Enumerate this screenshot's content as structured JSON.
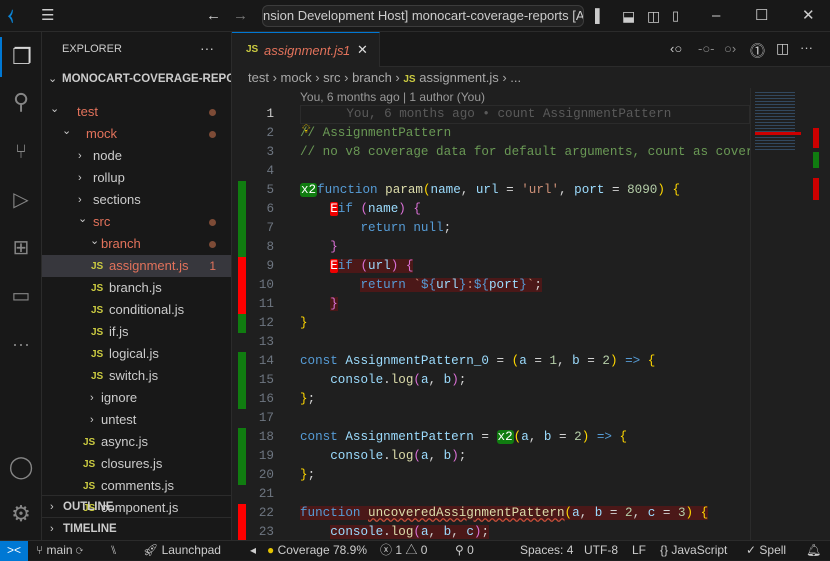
{
  "titlebar": {
    "title": "nsion Development Host] monocart-coverage-reports [Admi"
  },
  "sidebar": {
    "header": "EXPLORER",
    "more": "···",
    "root": "MONOCART-COVERAGE-REPO...",
    "outline": "OUTLINE",
    "timeline": "TIMELINE",
    "items": [
      {
        "label": "test",
        "kind": "folder-open",
        "depth": 0,
        "modified": true
      },
      {
        "label": "mock",
        "kind": "folder-open",
        "depth": 1,
        "modified": true
      },
      {
        "label": "node",
        "kind": "folder",
        "depth": 2
      },
      {
        "label": "rollup",
        "kind": "folder",
        "depth": 2
      },
      {
        "label": "sections",
        "kind": "folder",
        "depth": 2
      },
      {
        "label": "src",
        "kind": "folder-open",
        "depth": 2,
        "modified": true
      },
      {
        "label": "branch",
        "kind": "folder-open",
        "depth": 3,
        "modified": true
      },
      {
        "label": "assignment.js",
        "kind": "js",
        "depth": 4,
        "selected": true,
        "problems": "1"
      },
      {
        "label": "branch.js",
        "kind": "js",
        "depth": 4
      },
      {
        "label": "conditional.js",
        "kind": "js",
        "depth": 4
      },
      {
        "label": "if.js",
        "kind": "js",
        "depth": 4
      },
      {
        "label": "logical.js",
        "kind": "js",
        "depth": 4
      },
      {
        "label": "switch.js",
        "kind": "js",
        "depth": 4
      },
      {
        "label": "ignore",
        "kind": "folder",
        "depth": 3
      },
      {
        "label": "untest",
        "kind": "folder",
        "depth": 3
      },
      {
        "label": "async.js",
        "kind": "js",
        "depth": 3
      },
      {
        "label": "closures.js",
        "kind": "js",
        "depth": 3
      },
      {
        "label": "comments.js",
        "kind": "js",
        "depth": 3
      },
      {
        "label": "component.js",
        "kind": "js",
        "depth": 3
      }
    ]
  },
  "tab": {
    "icon": "JS",
    "label": "assignment.js",
    "problems": "1"
  },
  "breadcrumbs": [
    "test",
    "mock",
    "src",
    "branch",
    "assignment.js",
    "..."
  ],
  "blame": "You, 6 months ago | 1 author (You)",
  "code": {
    "lines": [
      {
        "n": "1",
        "cov": "",
        "t": [
          [
            "      You, 6 months ago • count AssignmentPattern",
            "ghost"
          ]
        ]
      },
      {
        "n": "2",
        "cov": "",
        "t": [
          [
            "// AssignmentPattern",
            "cm"
          ]
        ]
      },
      {
        "n": "3",
        "cov": "",
        "t": [
          [
            "// no v8 coverage data for default arguments, count as covered",
            "cm"
          ]
        ]
      },
      {
        "n": "4",
        "cov": "",
        "t": []
      },
      {
        "n": "5",
        "cov": "covered",
        "t": [
          [
            "x2",
            "bx2"
          ],
          [
            "function ",
            "kw"
          ],
          [
            "param",
            "fn"
          ],
          [
            "(",
            "b1"
          ],
          [
            "name",
            "var"
          ],
          [
            ", ",
            "p"
          ],
          [
            "url",
            "var"
          ],
          [
            " = ",
            "p"
          ],
          [
            "'url'",
            "str"
          ],
          [
            ", ",
            "p"
          ],
          [
            "port",
            "var"
          ],
          [
            " = ",
            "p"
          ],
          [
            "8090",
            "num"
          ],
          [
            ") ",
            "b1"
          ],
          [
            "{",
            "b1"
          ]
        ]
      },
      {
        "n": "6",
        "cov": "covered",
        "t": [
          [
            "    ",
            "p"
          ],
          [
            "E",
            "bE"
          ],
          [
            "if ",
            "kw"
          ],
          [
            "(",
            "b2"
          ],
          [
            "name",
            "var"
          ],
          [
            ") ",
            "b2"
          ],
          [
            "{",
            "b2"
          ]
        ]
      },
      {
        "n": "7",
        "cov": "covered",
        "t": [
          [
            "        return ",
            "kw"
          ],
          [
            "null",
            "kw"
          ],
          [
            ";",
            "p"
          ]
        ]
      },
      {
        "n": "8",
        "cov": "covered",
        "t": [
          [
            "    ",
            "p"
          ],
          [
            "}",
            "b2"
          ]
        ]
      },
      {
        "n": "9",
        "cov": "uncovered",
        "t": [
          [
            "    ",
            "p"
          ],
          [
            "E",
            "bE"
          ],
          [
            "if ",
            "kw unc"
          ],
          [
            "(",
            "b2 unc"
          ],
          [
            "url",
            "var unc"
          ],
          [
            ") ",
            "b2 unc"
          ],
          [
            "{",
            "b2 unc"
          ]
        ]
      },
      {
        "n": "10",
        "cov": "uncovered",
        "t": [
          [
            "        ",
            "p"
          ],
          [
            "return ",
            "kw unc"
          ],
          [
            "`",
            "str unc"
          ],
          [
            "${",
            "tpl unc"
          ],
          [
            "url",
            "var unc"
          ],
          [
            "}",
            "tpl unc"
          ],
          [
            ":",
            "str unc"
          ],
          [
            "${",
            "tpl unc"
          ],
          [
            "port",
            "var unc"
          ],
          [
            "}",
            "tpl unc"
          ],
          [
            "`",
            "str unc"
          ],
          [
            ";",
            "p unc"
          ]
        ]
      },
      {
        "n": "11",
        "cov": "uncovered",
        "t": [
          [
            "    ",
            "p"
          ],
          [
            "}",
            "b2 unc"
          ]
        ]
      },
      {
        "n": "12",
        "cov": "covered",
        "t": [
          [
            "}",
            "b1"
          ]
        ]
      },
      {
        "n": "13",
        "cov": "",
        "t": []
      },
      {
        "n": "14",
        "cov": "covered",
        "t": [
          [
            "const ",
            "kw"
          ],
          [
            "AssignmentPattern_0",
            "var"
          ],
          [
            " = ",
            "p"
          ],
          [
            "(",
            "b1"
          ],
          [
            "a",
            "var"
          ],
          [
            " = ",
            "p"
          ],
          [
            "1",
            "num"
          ],
          [
            ", ",
            "p"
          ],
          [
            "b",
            "var"
          ],
          [
            " = ",
            "p"
          ],
          [
            "2",
            "num"
          ],
          [
            ") ",
            "b1"
          ],
          [
            "=> ",
            "kw"
          ],
          [
            "{",
            "b1"
          ]
        ]
      },
      {
        "n": "15",
        "cov": "covered",
        "t": [
          [
            "    ",
            "p"
          ],
          [
            "console",
            "var"
          ],
          [
            ".",
            "p"
          ],
          [
            "log",
            "fn"
          ],
          [
            "(",
            "b2"
          ],
          [
            "a",
            "var"
          ],
          [
            ", ",
            "p"
          ],
          [
            "b",
            "var"
          ],
          [
            ")",
            "b2"
          ],
          [
            ";",
            "p"
          ]
        ]
      },
      {
        "n": "16",
        "cov": "covered",
        "t": [
          [
            "}",
            "b1"
          ],
          [
            ";",
            "p"
          ]
        ]
      },
      {
        "n": "17",
        "cov": "",
        "t": []
      },
      {
        "n": "18",
        "cov": "covered",
        "t": [
          [
            "const ",
            "kw"
          ],
          [
            "AssignmentPattern",
            "var"
          ],
          [
            " = ",
            "p"
          ],
          [
            "x2",
            "bx2"
          ],
          [
            "(",
            "b1"
          ],
          [
            "a",
            "var"
          ],
          [
            ", ",
            "p"
          ],
          [
            "b",
            "var"
          ],
          [
            " = ",
            "p"
          ],
          [
            "2",
            "num"
          ],
          [
            ") ",
            "b1"
          ],
          [
            "=> ",
            "kw"
          ],
          [
            "{",
            "b1"
          ]
        ]
      },
      {
        "n": "19",
        "cov": "covered",
        "t": [
          [
            "    ",
            "p"
          ],
          [
            "console",
            "var"
          ],
          [
            ".",
            "p"
          ],
          [
            "log",
            "fn"
          ],
          [
            "(",
            "b2"
          ],
          [
            "a",
            "var"
          ],
          [
            ", ",
            "p"
          ],
          [
            "b",
            "var"
          ],
          [
            ")",
            "b2"
          ],
          [
            ";",
            "p"
          ]
        ]
      },
      {
        "n": "20",
        "cov": "covered",
        "t": [
          [
            "}",
            "b1"
          ],
          [
            ";",
            "p"
          ]
        ]
      },
      {
        "n": "21",
        "cov": "",
        "t": []
      },
      {
        "n": "22",
        "cov": "uncovered",
        "t": [
          [
            "function ",
            "kw unc"
          ],
          [
            "uncoveredAssignmentPattern",
            "fn unc wavy"
          ],
          [
            "(",
            "b1 unc"
          ],
          [
            "a",
            "var unc"
          ],
          [
            ", ",
            "p unc"
          ],
          [
            "b",
            "var unc"
          ],
          [
            " = ",
            "p unc"
          ],
          [
            "2",
            "num unc"
          ],
          [
            ", ",
            "p unc"
          ],
          [
            "c",
            "var unc"
          ],
          [
            " = ",
            "p unc"
          ],
          [
            "3",
            "num unc"
          ],
          [
            ") ",
            "b1 unc"
          ],
          [
            "{",
            "b1 unc"
          ]
        ]
      },
      {
        "n": "23",
        "cov": "uncovered",
        "t": [
          [
            "    ",
            "p"
          ],
          [
            "console",
            "var unc"
          ],
          [
            ".",
            "p unc"
          ],
          [
            "log",
            "fn unc"
          ],
          [
            "(",
            "b2 unc"
          ],
          [
            "a",
            "var unc"
          ],
          [
            ", ",
            "p unc"
          ],
          [
            "b",
            "var unc"
          ],
          [
            ", ",
            "p unc"
          ],
          [
            "c",
            "var unc"
          ],
          [
            ")",
            "b2 unc"
          ],
          [
            ";",
            "p unc"
          ]
        ]
      }
    ]
  },
  "colors": {
    "covered": "#107c10",
    "uncovered": "#ff0000",
    "accent": "#0078d4"
  },
  "status": {
    "branch": "main",
    "launchpad": "Launchpad",
    "coverage": "Coverage 78.9%",
    "errors": "1",
    "warnings": "0",
    "ports": "0",
    "spaces": "Spaces: 4",
    "encoding": "UTF-8",
    "eol": "LF",
    "language": "JavaScript",
    "spell": "Spell"
  }
}
